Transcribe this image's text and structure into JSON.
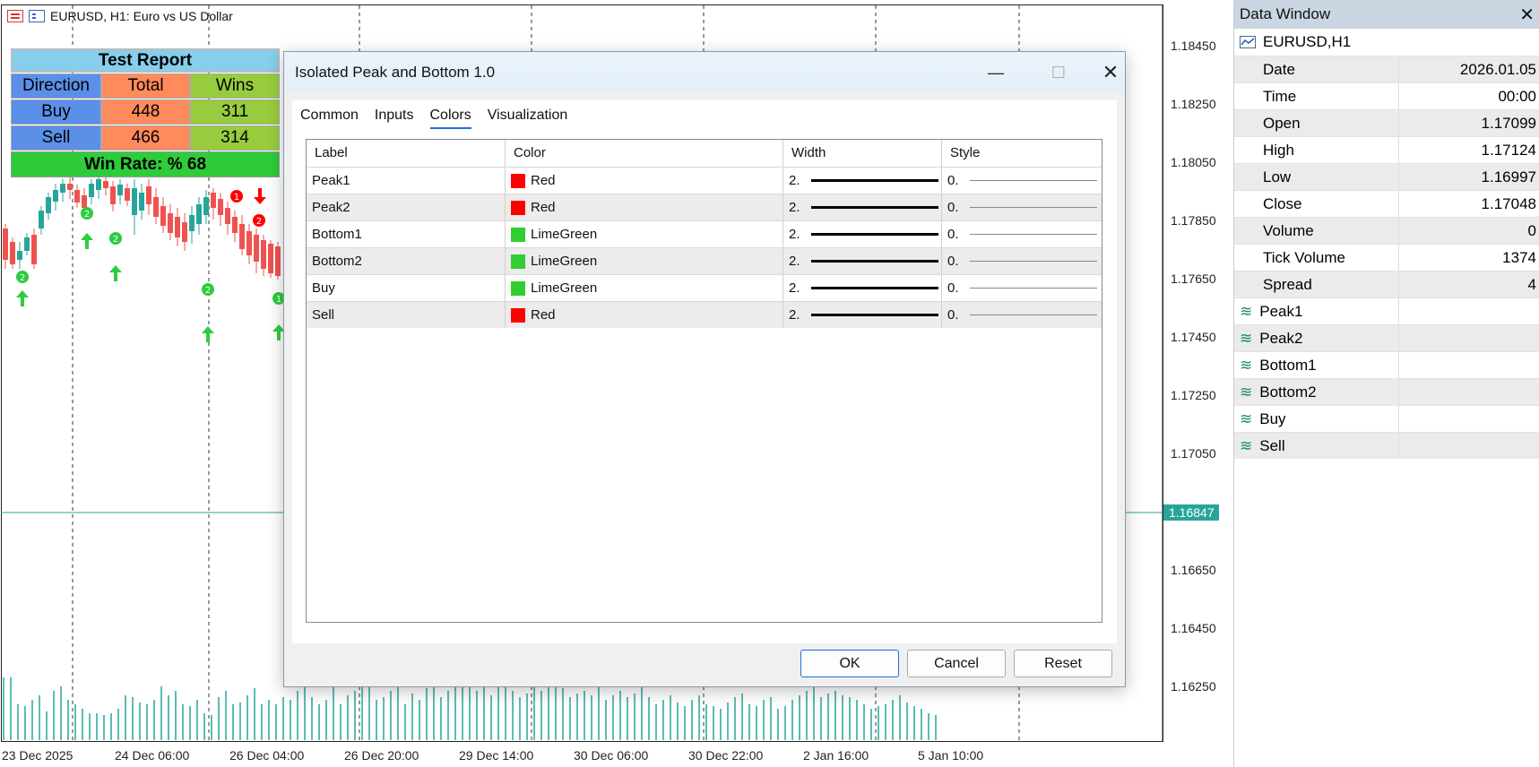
{
  "chart": {
    "title": "EURUSD, H1:  Euro vs US Dollar",
    "prices": [
      "1.18450",
      "1.18250",
      "1.18050",
      "1.17850",
      "1.17650",
      "1.17450",
      "1.17250",
      "1.17050",
      "1.16650",
      "1.16450",
      "1.16250"
    ],
    "current_price": "1.16847",
    "dates": [
      "23 Dec 2025",
      "24 Dec 06:00",
      "26 Dec 04:00",
      "26 Dec 20:00",
      "29 Dec 14:00",
      "30 Dec 06:00",
      "30 Dec 22:00",
      "2 Jan 16:00",
      "5 Jan 10:00"
    ],
    "marker_buy": "2",
    "marker_sell_1": "1",
    "marker_sell_2": "2",
    "marker_buy_1": "1",
    "colors": {
      "bull": "#26a69a",
      "bear": "#ef5350",
      "up_arrow": "#2ecc40",
      "down_arrow": "#ff0000"
    }
  },
  "report": {
    "title": "Test Report",
    "headers": [
      "Direction",
      "Total",
      "Wins"
    ],
    "rows": [
      [
        "Buy",
        "448",
        "311"
      ],
      [
        "Sell",
        "466",
        "314"
      ]
    ],
    "win_rate": "Win Rate: %  68"
  },
  "dialog": {
    "title": "Isolated Peak and Bottom 1.0",
    "tabs": [
      "Common",
      "Inputs",
      "Colors",
      "Visualization"
    ],
    "active_tab": "Colors",
    "columns": [
      "Label",
      "Color",
      "Width",
      "Style"
    ],
    "rows": [
      {
        "label": "Peak1",
        "color_name": "Red",
        "color": "#ff0000",
        "width": "2.",
        "style": "0."
      },
      {
        "label": "Peak2",
        "color_name": "Red",
        "color": "#ff0000",
        "width": "2.",
        "style": "0."
      },
      {
        "label": "Bottom1",
        "color_name": "LimeGreen",
        "color": "#32cd32",
        "width": "2.",
        "style": "0."
      },
      {
        "label": "Bottom2",
        "color_name": "LimeGreen",
        "color": "#32cd32",
        "width": "2.",
        "style": "0."
      },
      {
        "label": "Buy",
        "color_name": "LimeGreen",
        "color": "#32cd32",
        "width": "2.",
        "style": "0."
      },
      {
        "label": "Sell",
        "color_name": "Red",
        "color": "#ff0000",
        "width": "2.",
        "style": "0."
      }
    ],
    "buttons": {
      "ok": "OK",
      "cancel": "Cancel",
      "reset": "Reset"
    }
  },
  "data_window": {
    "title": "Data Window",
    "symbol": "EURUSD,H1",
    "rows": [
      {
        "k": "Date",
        "v": "2026.01.05"
      },
      {
        "k": "Time",
        "v": "00:00"
      },
      {
        "k": "Open",
        "v": "1.17099"
      },
      {
        "k": "High",
        "v": "1.17124"
      },
      {
        "k": "Low",
        "v": "1.16997"
      },
      {
        "k": "Close",
        "v": "1.17048"
      },
      {
        "k": "Volume",
        "v": "0"
      },
      {
        "k": "Tick Volume",
        "v": "1374"
      },
      {
        "k": "Spread",
        "v": "4"
      }
    ],
    "indicators": [
      "Peak1",
      "Peak2",
      "Bottom1",
      "Bottom2",
      "Buy",
      "Sell"
    ]
  }
}
